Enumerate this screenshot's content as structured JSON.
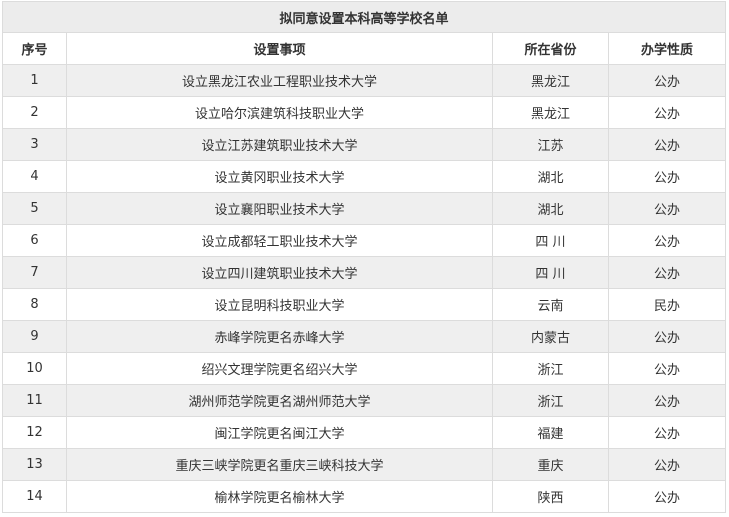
{
  "table": {
    "title": "拟同意设置本科高等学校名单",
    "headers": [
      "序号",
      "设置事项",
      "所在省份",
      "办学性质"
    ],
    "rows": [
      [
        "1",
        "设立黑龙江农业工程职业技术大学",
        "黑龙江",
        "公办"
      ],
      [
        "2",
        "设立哈尔滨建筑科技职业大学",
        "黑龙江",
        "公办"
      ],
      [
        "3",
        "设立江苏建筑职业技术大学",
        "江苏",
        "公办"
      ],
      [
        "4",
        "设立黄冈职业技术大学",
        "湖北",
        "公办"
      ],
      [
        "5",
        "设立襄阳职业技术大学",
        "湖北",
        "公办"
      ],
      [
        "6",
        "设立成都轻工职业技术大学",
        "四 川",
        "公办"
      ],
      [
        "7",
        "设立四川建筑职业技术大学",
        "四 川",
        "公办"
      ],
      [
        "8",
        "设立昆明科技职业大学",
        "云南",
        "民办"
      ],
      [
        "9",
        "赤峰学院更名赤峰大学",
        "内蒙古",
        "公办"
      ],
      [
        "10",
        "绍兴文理学院更名绍兴大学",
        "浙江",
        "公办"
      ],
      [
        "11",
        "湖州师范学院更名湖州师范大学",
        "浙江",
        "公办"
      ],
      [
        "12",
        "闽江学院更名闽江大学",
        "福建",
        "公办"
      ],
      [
        "13",
        "重庆三峡学院更名重庆三峡科技大学",
        "重庆",
        "公办"
      ],
      [
        "14",
        "榆林学院更名榆林大学",
        "陕西",
        "公办"
      ]
    ]
  }
}
